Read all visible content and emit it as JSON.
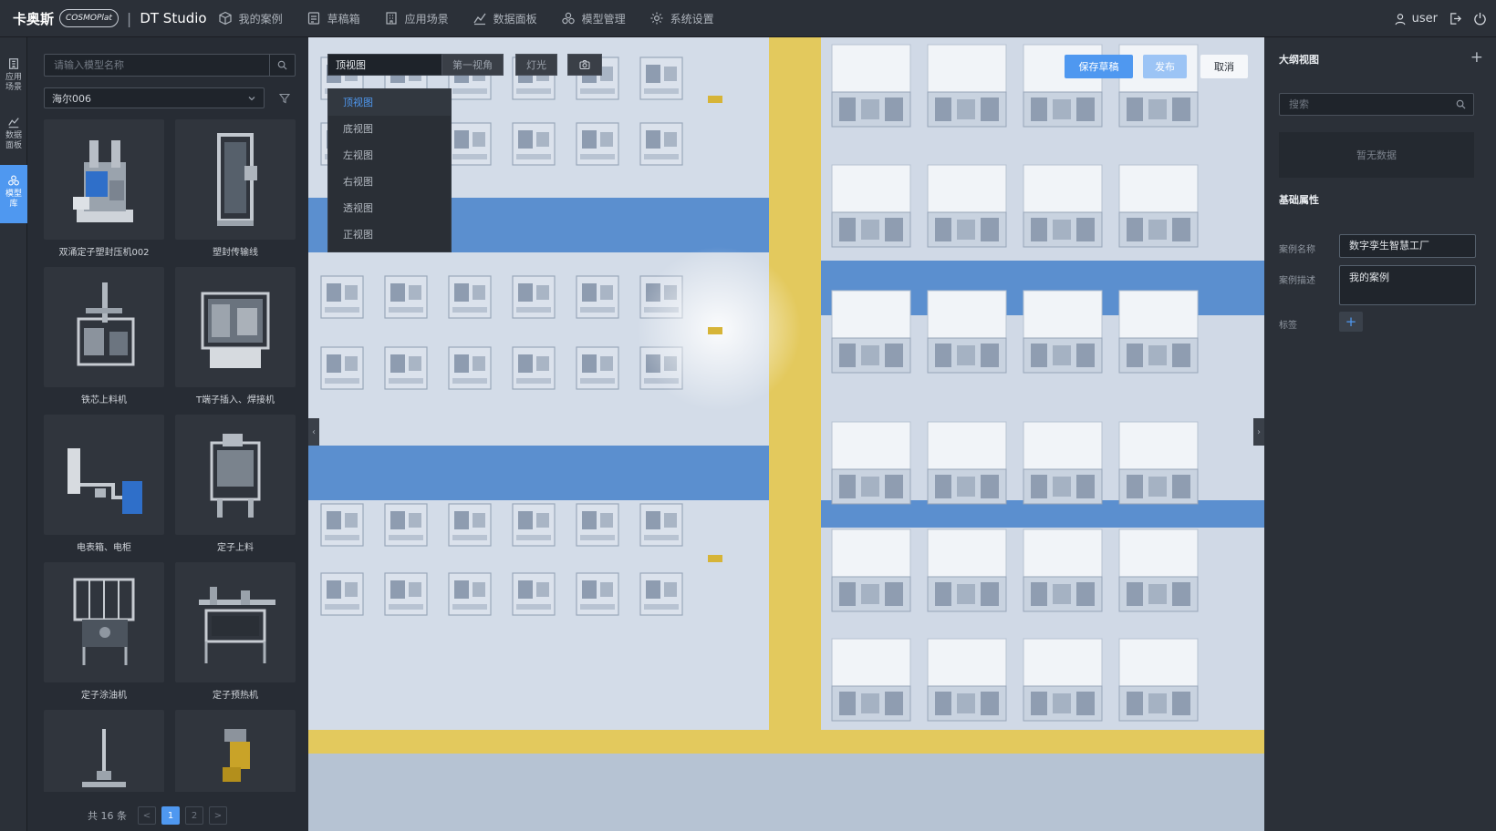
{
  "brand": {
    "name_cn": "卡奥斯",
    "logo_text": "COSMOPlat",
    "product": "DT Studio"
  },
  "nav": [
    {
      "label": "我的案例",
      "icon": "cube-icon"
    },
    {
      "label": "草稿箱",
      "icon": "drafts-icon"
    },
    {
      "label": "应用场景",
      "icon": "building-icon"
    },
    {
      "label": "数据面板",
      "icon": "chart-icon"
    },
    {
      "label": "模型管理",
      "icon": "model-icon"
    },
    {
      "label": "系统设置",
      "icon": "gear-icon"
    }
  ],
  "user": {
    "name": "user"
  },
  "rail": [
    {
      "label": "应用场景",
      "icon": "building-icon"
    },
    {
      "label": "数据面板",
      "icon": "chart-icon"
    },
    {
      "label": "模型库",
      "icon": "model-library-icon",
      "active": true
    }
  ],
  "model_panel": {
    "search_placeholder": "请输入模型名称",
    "category": "海尔006",
    "cards": [
      {
        "name": "双涌定子塑封压机002"
      },
      {
        "name": "塑封传输线"
      },
      {
        "name": "铁芯上料机"
      },
      {
        "name": "T端子插入、焊接机"
      },
      {
        "name": "电表箱、电柜"
      },
      {
        "name": "定子上料"
      },
      {
        "name": "定子涂油机"
      },
      {
        "name": "定子预热机"
      },
      {
        "name": ""
      },
      {
        "name": ""
      }
    ],
    "pagination": {
      "total_label": "共 16 条",
      "prev": "<",
      "pages": [
        "1",
        "2"
      ],
      "current": "1",
      "next": ">"
    }
  },
  "viewport": {
    "view_select": "顶视图",
    "first_person": "第一视角",
    "light": "灯光",
    "view_options": [
      "顶视图",
      "底视图",
      "左视图",
      "右视图",
      "透视图",
      "正视图"
    ],
    "selected_view": "顶视图",
    "save_draft": "保存草稿",
    "publish": "发布",
    "cancel": "取消",
    "colors": {
      "accent": "#4f98f0",
      "floor": "#c5d3e3",
      "lane": "#e5c95c",
      "blue_strip": "#5b8fcf"
    }
  },
  "outline": {
    "title": "大纲视图",
    "search_placeholder": "搜索",
    "empty": "暂无数据",
    "section": "基础属性",
    "fields": {
      "name_label": "案例名称",
      "name_value": "数字孪生智慧工厂",
      "desc_label": "案例描述",
      "desc_value": "我的案例",
      "tag_label": "标签"
    }
  }
}
